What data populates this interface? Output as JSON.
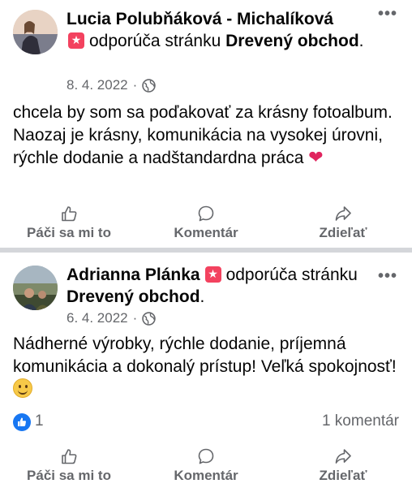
{
  "posts": [
    {
      "author": "Lucia Polubňáková - Michalíková",
      "recommend_text": "odporúča stránku",
      "page_name": "Drevený obchod",
      "trailing": ".",
      "date": "8. 4. 2022",
      "dot": "·",
      "body": "chcela by som sa poďakovať za krásny fotoalbum. Naozaj je krásny, komunikácia na vysokej úrovni, rýchle dodanie a nadštandardna práca",
      "emoji": "❤️",
      "actions": {
        "like": "Páči sa mi to",
        "comment": "Komentár",
        "share": "Zdieľať"
      },
      "more": "•••"
    },
    {
      "author": "Adrianna Plánka",
      "recommend_text": "odporúča stránku",
      "page_name": "Drevený obchod",
      "trailing": ".",
      "date": "6. 4. 2022",
      "dot": "·",
      "body": "Nádherné výrobky, rýchle dodanie, príjemná komunikácia a dokonalý prístup! Veľká spokojnosť!",
      "emoji": "🙂",
      "reactions": {
        "count": "1",
        "comments": "1 komentár"
      },
      "actions": {
        "like": "Páči sa mi to",
        "comment": "Komentár",
        "share": "Zdieľať"
      },
      "more": "•••"
    }
  ],
  "icons": {
    "recommend": "recommend-star-icon",
    "privacy": "globe-icon",
    "like": "thumbs-up-icon",
    "comment": "comment-bubble-icon",
    "share": "share-arrow-icon",
    "reaction": "like-reaction-icon"
  },
  "colors": {
    "recommend_badge": "#f3425f",
    "meta_gray": "#65676b",
    "like_blue": "#1877f2",
    "divider": "#d4d6da"
  }
}
